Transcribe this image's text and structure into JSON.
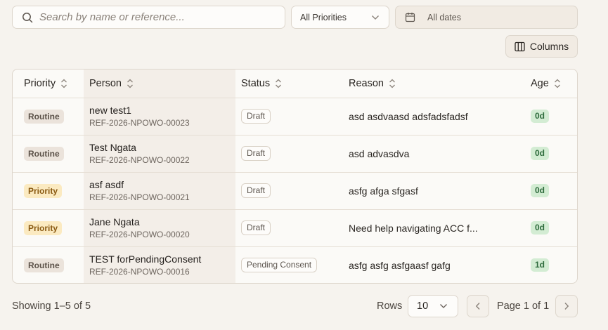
{
  "filters": {
    "search_placeholder": "Search by name or reference...",
    "priority_value": "All Priorities",
    "date_value": "All dates"
  },
  "toolbar": {
    "columns_label": "Columns"
  },
  "table": {
    "headers": {
      "priority": "Priority",
      "person": "Person",
      "status": "Status",
      "reason": "Reason",
      "age": "Age"
    },
    "rows": [
      {
        "priority": "Routine",
        "priority_level": "routine",
        "name": "new test1",
        "ref": "REF-2026-NPOWO-00023",
        "status": "Draft",
        "reason": "asd asdvaasd adsfadsfadsf",
        "age": "0d"
      },
      {
        "priority": "Routine",
        "priority_level": "routine",
        "name": "Test Ngata",
        "ref": "REF-2026-NPOWO-00022",
        "status": "Draft",
        "reason": "asd advasdva",
        "age": "0d"
      },
      {
        "priority": "Priority",
        "priority_level": "priority",
        "name": "asf asdf",
        "ref": "REF-2026-NPOWO-00021",
        "status": "Draft",
        "reason": "asfg afga sfgasf",
        "age": "0d"
      },
      {
        "priority": "Priority",
        "priority_level": "priority",
        "name": "Jane Ngata",
        "ref": "REF-2026-NPOWO-00020",
        "status": "Draft",
        "reason": "Need help navigating ACC f...",
        "age": "0d"
      },
      {
        "priority": "Routine",
        "priority_level": "routine",
        "name": "TEST forPendingConsent",
        "ref": "REF-2026-NPOWO-00016",
        "status": "Pending Consent",
        "reason": "asfg asfg asfgaasf gafg",
        "age": "1d"
      }
    ]
  },
  "footer": {
    "showing": "Showing 1–5 of 5",
    "rows_label": "Rows",
    "rows_value": "10",
    "page_info": "Page 1 of 1"
  },
  "colors": {
    "background": "#f6f3ee",
    "routine_badge": "#ebe3db",
    "priority_badge": "#fbeac1",
    "age_badge": "#d3ecd3"
  },
  "icons": [
    "search-icon",
    "chevron-down-icon",
    "calendar-icon",
    "columns-icon",
    "sort-icon",
    "chevron-left-icon",
    "chevron-right-icon"
  ]
}
